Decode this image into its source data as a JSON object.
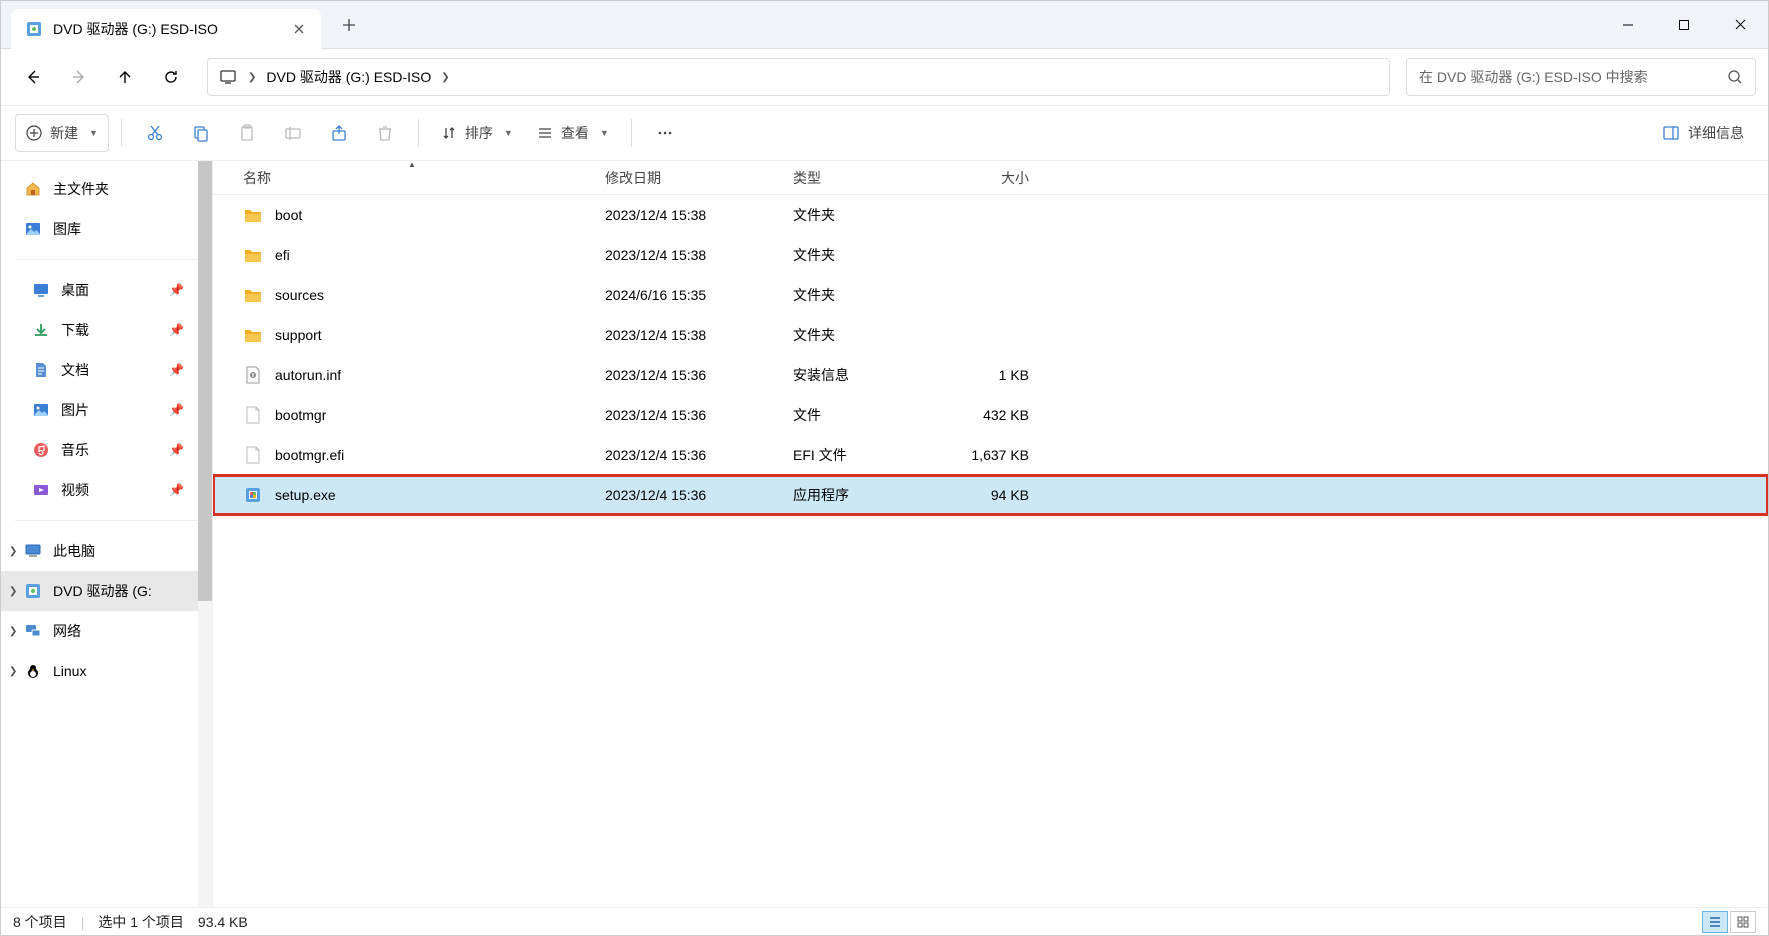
{
  "tab": {
    "title": "DVD 驱动器 (G:) ESD-ISO"
  },
  "breadcrumb": {
    "segments": [
      "DVD 驱动器 (G:) ESD-ISO"
    ]
  },
  "search": {
    "placeholder": "在 DVD 驱动器 (G:) ESD-ISO 中搜索"
  },
  "toolbar": {
    "new": "新建",
    "sort": "排序",
    "view": "查看",
    "details": "详细信息"
  },
  "sidebar": {
    "home": "主文件夹",
    "gallery": "图库",
    "desktop": "桌面",
    "downloads": "下载",
    "documents": "文档",
    "pictures": "图片",
    "music": "音乐",
    "videos": "视频",
    "this_pc": "此电脑",
    "dvd": "DVD 驱动器 (G:",
    "network": "网络",
    "linux": "Linux"
  },
  "columns": {
    "name": "名称",
    "date": "修改日期",
    "type": "类型",
    "size": "大小"
  },
  "files": [
    {
      "name": "boot",
      "date": "2023/12/4 15:38",
      "type": "文件夹",
      "size": "",
      "icon": "folder"
    },
    {
      "name": "efi",
      "date": "2023/12/4 15:38",
      "type": "文件夹",
      "size": "",
      "icon": "folder"
    },
    {
      "name": "sources",
      "date": "2024/6/16 15:35",
      "type": "文件夹",
      "size": "",
      "icon": "folder"
    },
    {
      "name": "support",
      "date": "2023/12/4 15:38",
      "type": "文件夹",
      "size": "",
      "icon": "folder"
    },
    {
      "name": "autorun.inf",
      "date": "2023/12/4 15:36",
      "type": "安装信息",
      "size": "1 KB",
      "icon": "inf"
    },
    {
      "name": "bootmgr",
      "date": "2023/12/4 15:36",
      "type": "文件",
      "size": "432 KB",
      "icon": "file"
    },
    {
      "name": "bootmgr.efi",
      "date": "2023/12/4 15:36",
      "type": "EFI 文件",
      "size": "1,637 KB",
      "icon": "file"
    },
    {
      "name": "setup.exe",
      "date": "2023/12/4 15:36",
      "type": "应用程序",
      "size": "94 KB",
      "icon": "exe",
      "selected": true,
      "highlighted": true
    }
  ],
  "status": {
    "items": "8 个项目",
    "selected": "选中 1 个项目",
    "size": "93.4 KB"
  }
}
